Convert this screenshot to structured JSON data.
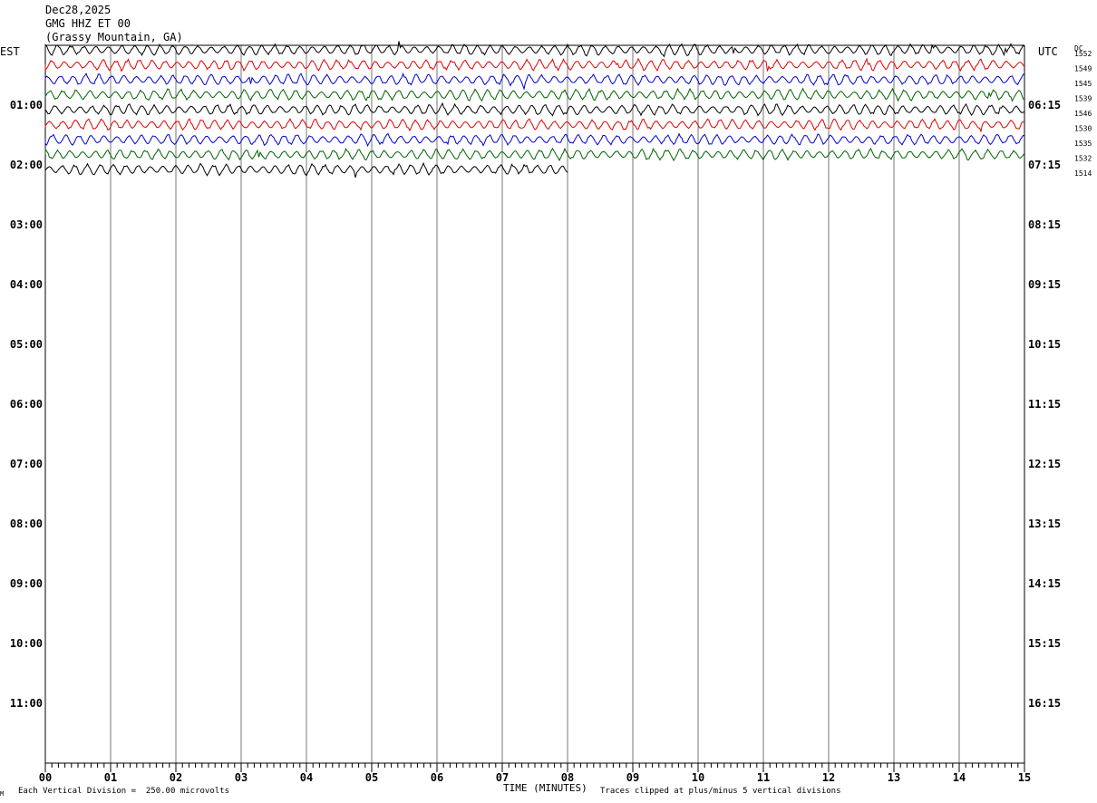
{
  "header": {
    "date": "Dec28,2025",
    "station": "GMG HHZ ET 00",
    "location": "(Grassy Mountain, GA)"
  },
  "labels": {
    "left_tz": "EST",
    "right_tz": "UTC",
    "dc": "DC",
    "xlabel": "TIME (MINUTES)",
    "scale_note": "Each Vertical Division =  250.00 microvolts",
    "clip_note": "Traces clipped at plus/minus 5 vertical divisions",
    "corner_mark": "M"
  },
  "chart_data": {
    "type": "line",
    "title": "GMG HHZ ET 00 (Grassy Mountain, GA)",
    "xlabel": "TIME (MINUTES)",
    "x_ticks": [
      "00",
      "01",
      "02",
      "03",
      "04",
      "05",
      "06",
      "07",
      "08",
      "09",
      "10",
      "11",
      "12",
      "13",
      "14",
      "15"
    ],
    "xlim": [
      0,
      15
    ],
    "grid": true,
    "hour_rows": [
      {
        "est": "",
        "utc": ""
      },
      {
        "est": "01:00",
        "utc": "06:15"
      },
      {
        "est": "02:00",
        "utc": "07:15"
      },
      {
        "est": "03:00",
        "utc": "08:15"
      },
      {
        "est": "04:00",
        "utc": "09:15"
      },
      {
        "est": "05:00",
        "utc": "10:15"
      },
      {
        "est": "06:00",
        "utc": "11:15"
      },
      {
        "est": "07:00",
        "utc": "12:15"
      },
      {
        "est": "08:00",
        "utc": "13:15"
      },
      {
        "est": "09:00",
        "utc": "14:15"
      },
      {
        "est": "10:00",
        "utc": "15:15"
      },
      {
        "est": "11:00",
        "utc": "16:15"
      }
    ],
    "traces": [
      {
        "color": "#000000",
        "dc": "1552",
        "end_minute": 15
      },
      {
        "color": "#e00000",
        "dc": "1549",
        "end_minute": 15
      },
      {
        "color": "#0000d0",
        "dc": "1545",
        "end_minute": 15
      },
      {
        "color": "#006000",
        "dc": "1539",
        "end_minute": 15
      },
      {
        "color": "#000000",
        "dc": "1546",
        "end_minute": 15
      },
      {
        "color": "#e00000",
        "dc": "1530",
        "end_minute": 15
      },
      {
        "color": "#0000d0",
        "dc": "1535",
        "end_minute": 15
      },
      {
        "color": "#006000",
        "dc": "1532",
        "end_minute": 15
      },
      {
        "color": "#000000",
        "dc": "1514",
        "end_minute": 8
      }
    ]
  }
}
